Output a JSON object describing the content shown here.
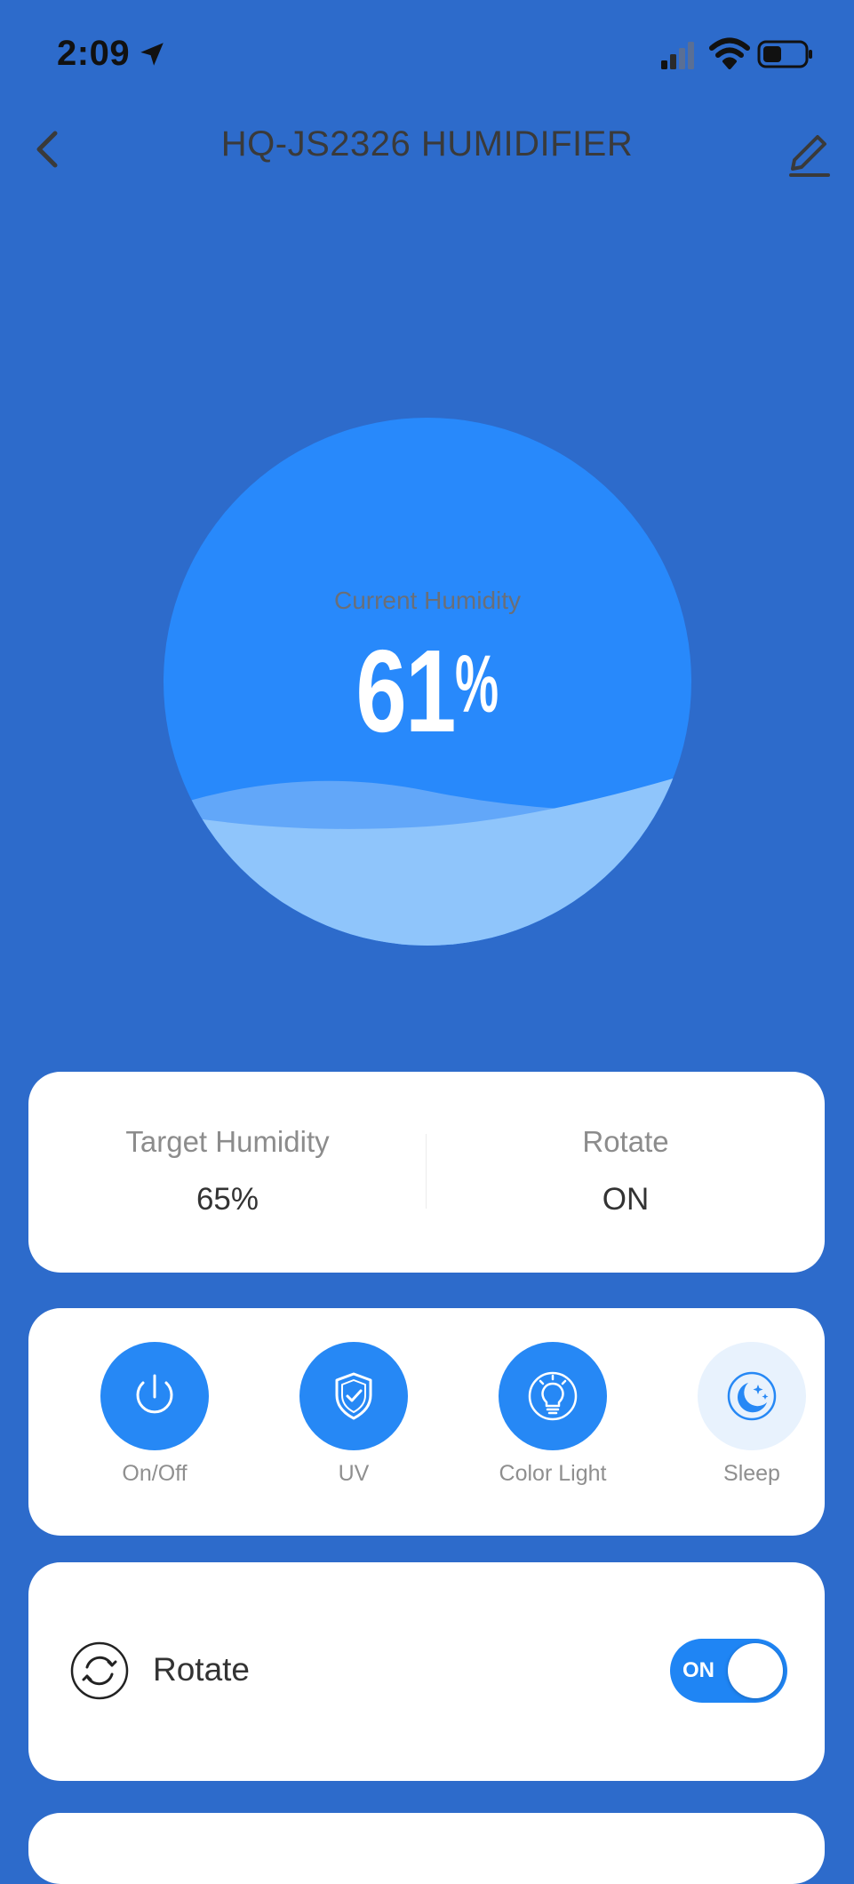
{
  "status_bar": {
    "time": "2:09"
  },
  "header": {
    "title": "HQ-JS2326 HUMIDIFIER"
  },
  "gauge": {
    "label": "Current Humidity",
    "value": "61",
    "unit": "%",
    "level_percent": 61
  },
  "summary": {
    "target_label": "Target Humidity",
    "target_value": "65%",
    "rotate_label": "Rotate",
    "rotate_value": "ON"
  },
  "controls": [
    {
      "label": "On/Off",
      "icon": "power-icon",
      "active": true
    },
    {
      "label": "UV",
      "icon": "shield-check-icon",
      "active": true
    },
    {
      "label": "Color Light",
      "icon": "lightbulb-icon",
      "active": true
    },
    {
      "label": "Sleep",
      "icon": "moon-stars-icon",
      "active": false
    }
  ],
  "rotate_row": {
    "label": "Rotate",
    "toggle_text": "ON",
    "enabled": true
  },
  "colors": {
    "background": "#2d6bcb",
    "accent": "#2688f5",
    "circle": "#2889fb",
    "wave": "#8fc5fb"
  }
}
